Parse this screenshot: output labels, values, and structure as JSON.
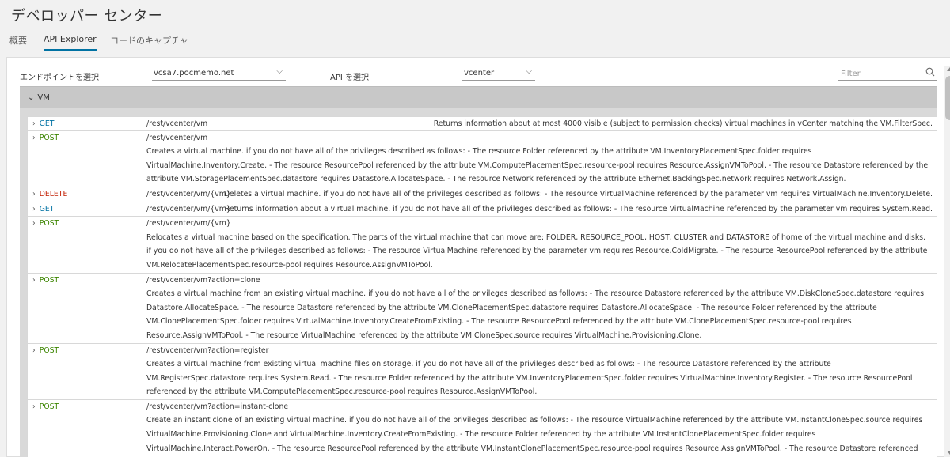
{
  "page_title": "デベロッパー センター",
  "tabs": [
    {
      "label": "概要",
      "active": false
    },
    {
      "label": "API Explorer",
      "active": true
    },
    {
      "label": "コードのキャプチャ",
      "active": false
    }
  ],
  "toolbar": {
    "endpoint_label": "エンドポイントを選択",
    "endpoint_value": "vcsa7.pocmemo.net",
    "api_label": "API を選択",
    "api_value": "vcenter",
    "filter_placeholder": "Filter"
  },
  "group": {
    "label": "VM",
    "expanded": true
  },
  "colors": {
    "get": "#0072a3",
    "post": "#3c8500",
    "delete": "#c21d00",
    "group_bg": "#c8c8c8"
  },
  "endpoints": [
    {
      "method": "GET",
      "path": "/rest/vcenter/vm",
      "description": "Returns information about at most 4000 visible (subject to permission checks) virtual machines in vCenter matching the VM.FilterSpec."
    },
    {
      "method": "POST",
      "path": "/rest/vcenter/vm",
      "description": "Creates a virtual machine. if you do not have all of the privileges described as follows: - The resource Folder referenced by the attribute VM.InventoryPlacementSpec.folder requires VirtualMachine.Inventory.Create. - The resource ResourcePool referenced by the attribute VM.ComputePlacementSpec.resource-pool requires Resource.AssignVMToPool. - The resource Datastore referenced by the attribute VM.StoragePlacementSpec.datastore requires Datastore.AllocateSpace. - The resource Network referenced by the attribute Ethernet.BackingSpec.network requires Network.Assign."
    },
    {
      "method": "DELETE",
      "path": "/rest/vcenter/vm/{vm}",
      "description": "Deletes a virtual machine. if you do not have all of the privileges described as follows: - The resource VirtualMachine referenced by the parameter vm requires VirtualMachine.Inventory.Delete."
    },
    {
      "method": "GET",
      "path": "/rest/vcenter/vm/{vm}",
      "description": "Returns information about a virtual machine. if you do not have all of the privileges described as follows: - The resource VirtualMachine referenced by the parameter vm requires System.Read."
    },
    {
      "method": "POST",
      "path": "/rest/vcenter/vm/{vm}",
      "description": "Relocates a virtual machine based on the specification. The parts of the virtual machine that can move are: FOLDER, RESOURCE_POOL, HOST, CLUSTER and DATASTORE of home of the virtual machine and disks. if you do not have all of the privileges described as follows: - The resource VirtualMachine referenced by the parameter vm requires Resource.ColdMigrate. - The resource ResourcePool referenced by the attribute VM.RelocatePlacementSpec.resource-pool requires Resource.AssignVMToPool."
    },
    {
      "method": "POST",
      "path": "/rest/vcenter/vm?action=clone",
      "description": "Creates a virtual machine from an existing virtual machine. if you do not have all of the privileges described as follows: - The resource Datastore referenced by the attribute VM.DiskCloneSpec.datastore requires Datastore.AllocateSpace. - The resource Datastore referenced by the attribute VM.ClonePlacementSpec.datastore requires Datastore.AllocateSpace. - The resource Folder referenced by the attribute VM.ClonePlacementSpec.folder requires VirtualMachine.Inventory.CreateFromExisting. - The resource ResourcePool referenced by the attribute VM.ClonePlacementSpec.resource-pool requires Resource.AssignVMToPool. - The resource VirtualMachine referenced by the attribute VM.CloneSpec.source requires VirtualMachine.Provisioning.Clone."
    },
    {
      "method": "POST",
      "path": "/rest/vcenter/vm?action=register",
      "description": "Creates a virtual machine from existing virtual machine files on storage. if you do not have all of the privileges described as follows: - The resource Datastore referenced by the attribute VM.RegisterSpec.datastore requires System.Read. - The resource Folder referenced by the attribute VM.InventoryPlacementSpec.folder requires VirtualMachine.Inventory.Register. - The resource ResourcePool referenced by the attribute VM.ComputePlacementSpec.resource-pool requires Resource.AssignVMToPool."
    },
    {
      "method": "POST",
      "path": "/rest/vcenter/vm?action=instant-clone",
      "description": "Create an instant clone of an existing virtual machine. if you do not have all of the privileges described as follows: - The resource VirtualMachine referenced by the attribute VM.InstantCloneSpec.source requires VirtualMachine.Provisioning.Clone and VirtualMachine.Inventory.CreateFromExisting. - The resource Folder referenced by the attribute VM.InstantClonePlacementSpec.folder requires VirtualMachine.Interact.PowerOn. - The resource ResourcePool referenced by the attribute VM.InstantClonePlacementSpec.resource-pool requires Resource.AssignVMToPool. - The resource Datastore referenced by the attribute"
    }
  ]
}
